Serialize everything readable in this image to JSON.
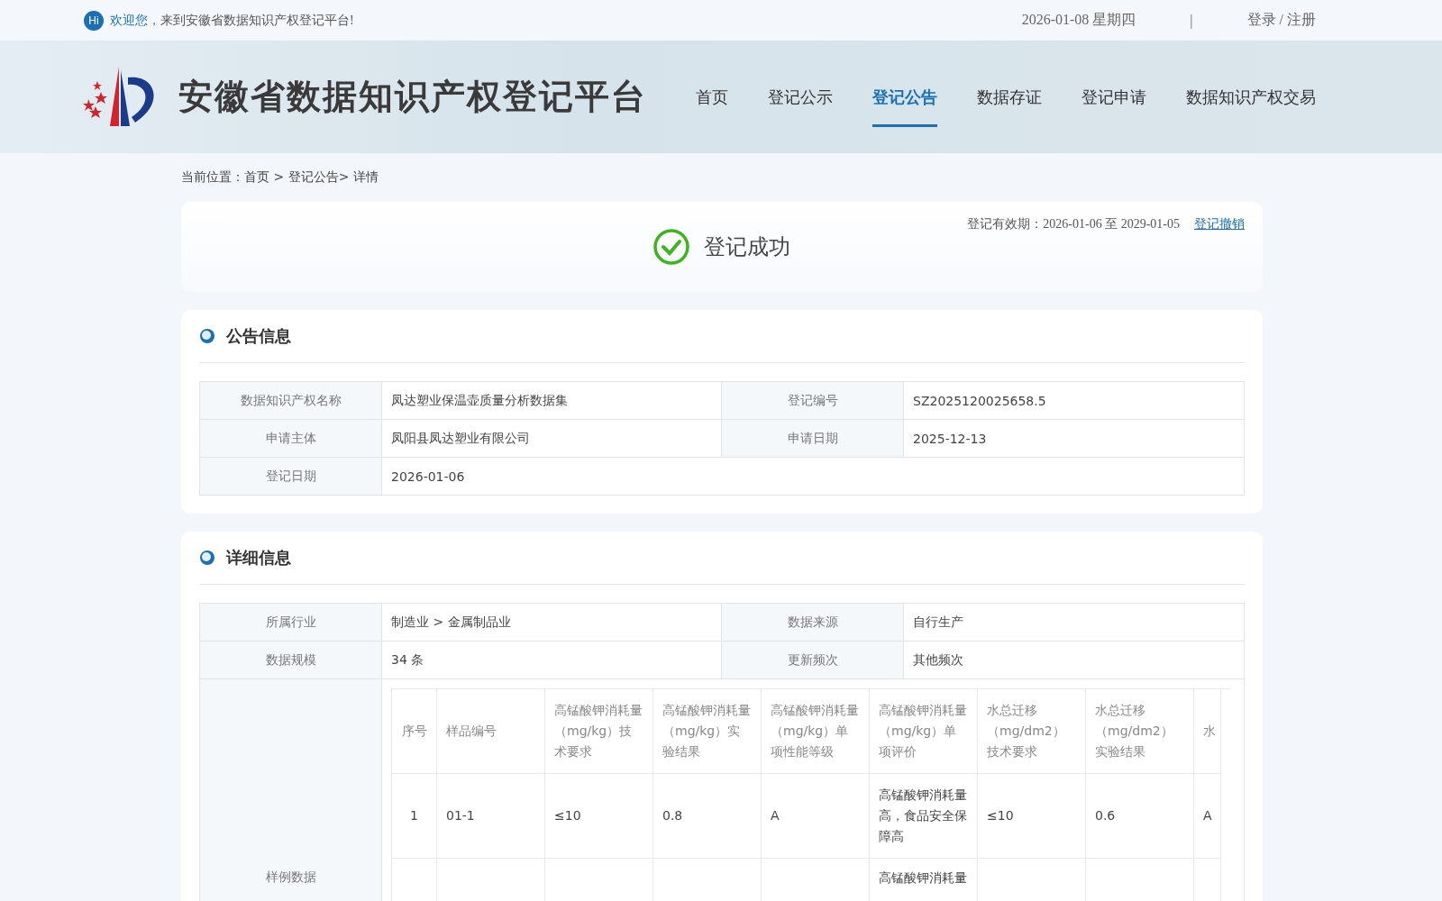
{
  "top_bar": {
    "badge": "Hi",
    "greeting": "欢迎您，",
    "welcome": "来到安徽省数据知识产权登记平台!",
    "date": "2026-01-08 星期四",
    "separator": "|",
    "login": "登录 / 注册"
  },
  "header": {
    "title": "安徽省数据知识产权登记平台",
    "nav": [
      {
        "label": "首页",
        "selected": false
      },
      {
        "label": "登记公示",
        "selected": false
      },
      {
        "label": "登记公告",
        "selected": true
      },
      {
        "label": "数据存证",
        "selected": false
      },
      {
        "label": "登记申请",
        "selected": false
      },
      {
        "label": "数据知识产权交易",
        "selected": false
      }
    ]
  },
  "breadcrumb": {
    "label": "当前位置：",
    "path": "首页 > 登记公告> 详情"
  },
  "status": {
    "title": "登记成功",
    "validity_label": "登记有效期：",
    "validity": "2026-01-06 至 2029-01-05",
    "revoke_link": "登记撤销"
  },
  "notice": {
    "title": "公告信息",
    "rows": [
      [
        {
          "label": "数据知识产权名称",
          "value": "凤达塑业保温壶质量分析数据集"
        },
        {
          "label": "登记编号",
          "value": "SZ2025120025658.5"
        }
      ],
      [
        {
          "label": "申请主体",
          "value": "凤阳县凤达塑业有限公司"
        },
        {
          "label": "申请日期",
          "value": "2025-12-13"
        }
      ],
      [
        {
          "label": "登记日期",
          "value": "2026-01-06"
        }
      ]
    ]
  },
  "details": {
    "title": "详细信息",
    "rows": [
      [
        {
          "label": "所属行业",
          "value": "制造业 > 金属制品业"
        },
        {
          "label": "数据来源",
          "value": "自行生产"
        }
      ],
      [
        {
          "label": "数据规模",
          "value": "34 条"
        },
        {
          "label": "更新频次",
          "value": "其他频次"
        }
      ]
    ],
    "sample": {
      "label": "样例数据",
      "columns": [
        "序号",
        "样品编号",
        "高锰酸钾消耗量（mg/kg）技术要求",
        "高锰酸钾消耗量（mg/kg）实验结果",
        "高锰酸钾消耗量（mg/kg）单项性能等级",
        "高锰酸钾消耗量（mg/kg）单项评价",
        "水总迁移（mg/dm2）技术要求",
        "水总迁移（mg/dm2）实验结果",
        "水"
      ],
      "rows": [
        [
          "1",
          "01-1",
          "≤10",
          "0.8",
          "A",
          "高锰酸钾消耗量高，食品安全保障高",
          "≤10",
          "0.6",
          "A"
        ]
      ],
      "cut_row": {
        "column_6": "高锰酸钾消耗量"
      }
    }
  }
}
